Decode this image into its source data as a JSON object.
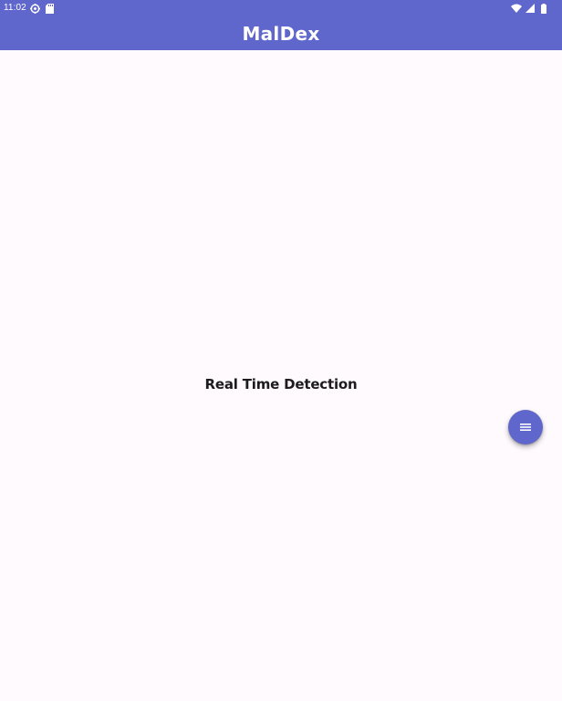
{
  "status_bar": {
    "time": "11:02",
    "left_icons": [
      "settings-gear-icon",
      "sd-card-icon"
    ],
    "right_icons": [
      "wifi-icon",
      "cell-signal-icon",
      "battery-icon"
    ]
  },
  "app_bar": {
    "title": "MalDex"
  },
  "main": {
    "label": "Real Time Detection"
  },
  "fab": {
    "icon": "menu-icon"
  },
  "colors": {
    "primary": "#5f66cc",
    "background": "#fefafd",
    "on_primary": "#ffffff",
    "text": "#1d1b20"
  }
}
